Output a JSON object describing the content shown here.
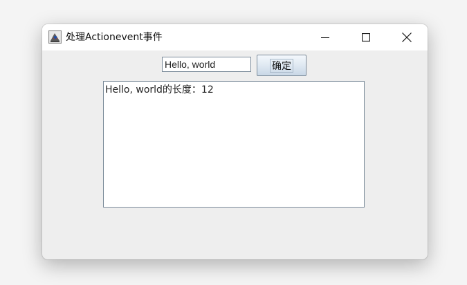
{
  "window": {
    "title": "处理Actionevent事件",
    "controls": {
      "minimize_icon": "minimize-icon",
      "maximize_icon": "maximize-icon",
      "close_icon": "close-icon"
    }
  },
  "form": {
    "input_value": "Hello, world",
    "button_label": "确定"
  },
  "output": {
    "text": "Hello, world的长度：12"
  },
  "colors": {
    "titlebar": "#ffffff",
    "window_body": "#eeeeee",
    "field_border": "#7a8a99",
    "button_gradient_top": "#f4f8fc",
    "button_gradient_bottom": "#c9d7e6"
  }
}
